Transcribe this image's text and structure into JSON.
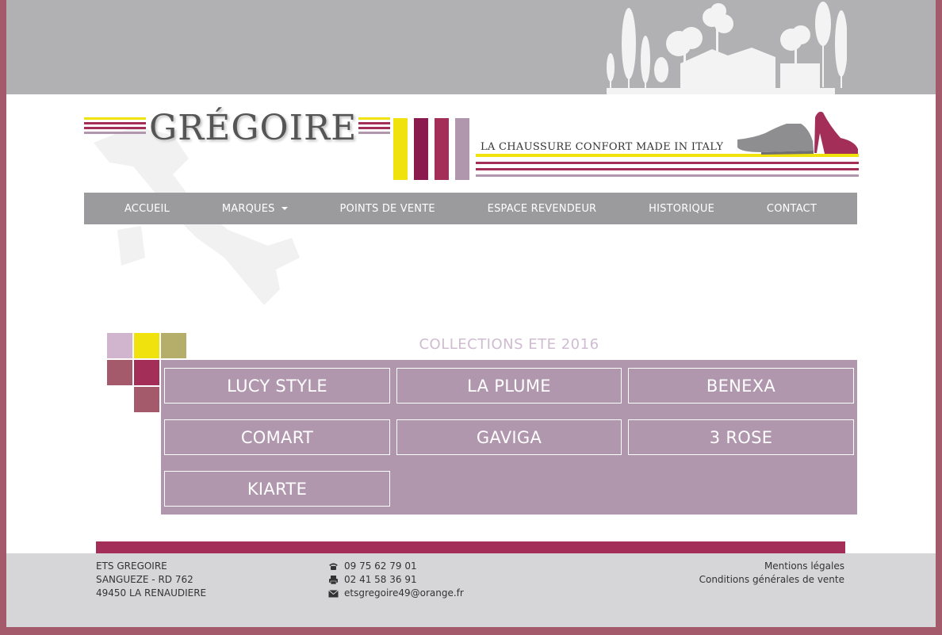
{
  "header": {
    "logo_text": "GRÉGOIRE",
    "tagline": "LA CHAUSSURE CONFORT MADE IN ITALY"
  },
  "nav": {
    "items": [
      {
        "label": "ACCUEIL"
      },
      {
        "label": "MARQUES"
      },
      {
        "label": "POINTS DE VENTE"
      },
      {
        "label": "ESPACE REVENDEUR"
      },
      {
        "label": "HISTORIQUE"
      },
      {
        "label": "CONTACT"
      }
    ]
  },
  "collections": {
    "title": "COLLECTIONS ETE 2016",
    "brands": [
      "LUCY STYLE",
      "LA PLUME",
      "BENEXA",
      "COMART",
      "GAVIGA",
      "3 ROSE",
      "KIARTE"
    ]
  },
  "footer": {
    "company": "ETS GREGOIRE",
    "address_line1": "SANGUEZE - RD 762",
    "address_line2": "49450 LA RENAUDIERE",
    "phone": "09 75 62 79 01",
    "fax": "02 41 58 36 91",
    "email": "etsgregoire49@orange.fr",
    "legal": "Mentions légales",
    "terms": "Conditions générales de vente"
  },
  "colors": {
    "yellow": "#f0e20c",
    "magenta": "#a32f58",
    "berry": "#8b1a4e",
    "mauve": "#b097ad",
    "nav_gray": "#9b9b9d",
    "frame": "#a45a6b"
  },
  "icons": {
    "phone": "phone-icon",
    "fax": "fax-icon",
    "email": "envelope-icon"
  }
}
